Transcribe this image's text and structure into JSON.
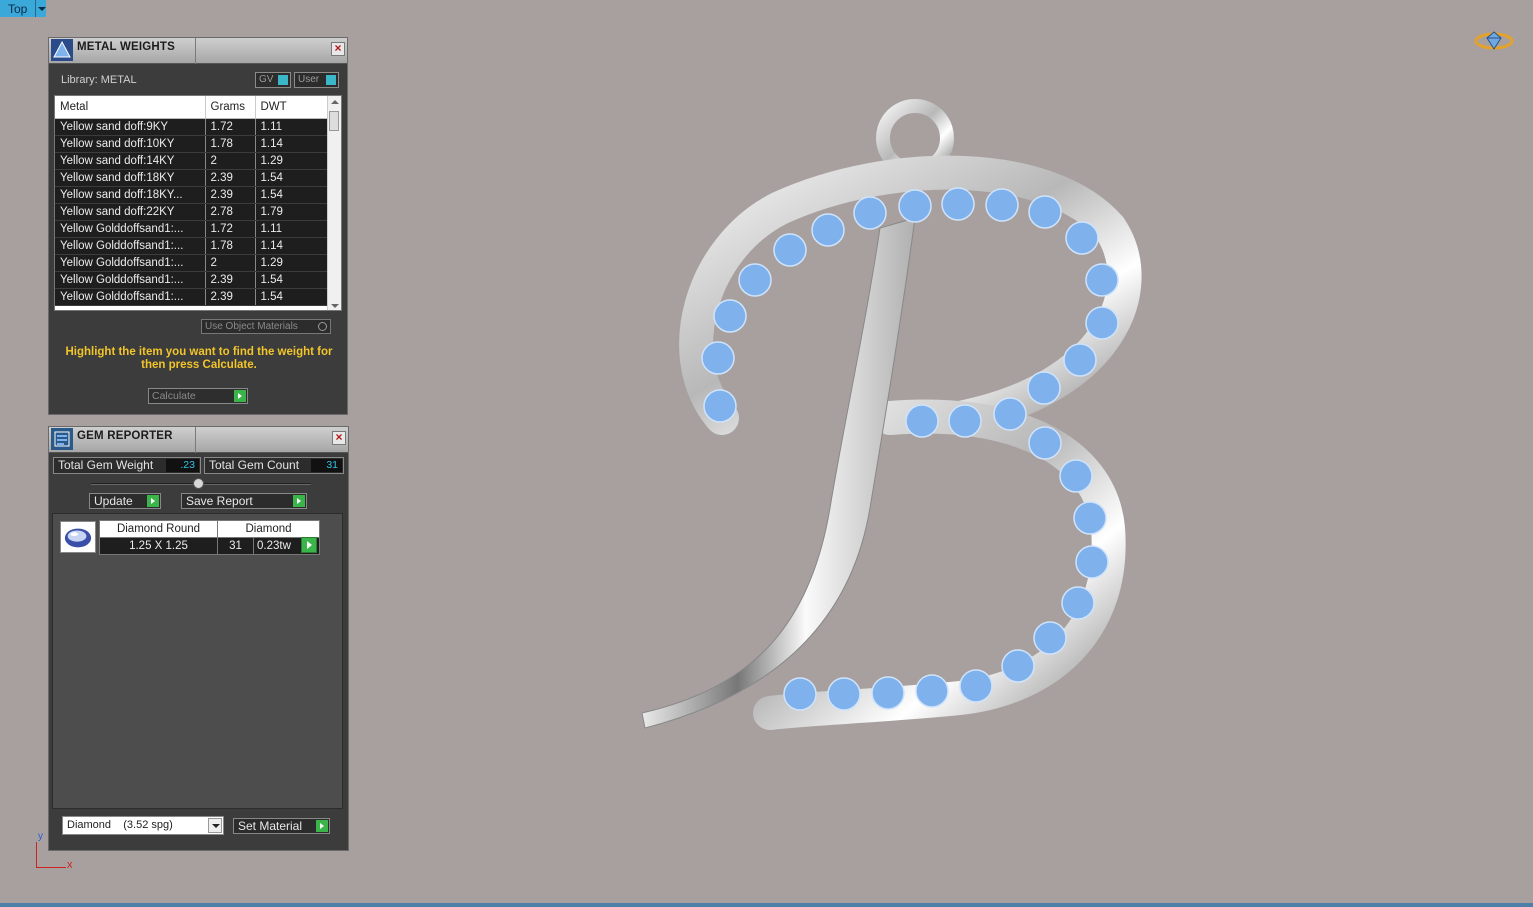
{
  "viewport": {
    "label": "Top",
    "axis_x": "x",
    "axis_y": "y"
  },
  "metal_weights": {
    "title": "METAL WEIGHTS",
    "library": "Library: METAL",
    "gv_label": "GV",
    "user_label": "User",
    "columns": [
      "Metal",
      "Grams",
      "DWT"
    ],
    "rows": [
      [
        "Yellow sand doff:9KY",
        "1.72",
        "1.11"
      ],
      [
        "Yellow sand doff:10KY",
        "1.78",
        "1.14"
      ],
      [
        "Yellow sand doff:14KY",
        "2",
        "1.29"
      ],
      [
        "Yellow sand doff:18KY",
        "2.39",
        "1.54"
      ],
      [
        "Yellow sand doff:18KY...",
        "2.39",
        "1.54"
      ],
      [
        "Yellow sand doff:22KY",
        "2.78",
        "1.79"
      ],
      [
        "Yellow Golddoffsand1:...",
        "1.72",
        "1.11"
      ],
      [
        "Yellow Golddoffsand1:...",
        "1.78",
        "1.14"
      ],
      [
        "Yellow Golddoffsand1:...",
        "2",
        "1.29"
      ],
      [
        "Yellow Golddoffsand1:...",
        "2.39",
        "1.54"
      ],
      [
        "Yellow Golddoffsand1:...",
        "2.39",
        "1.54"
      ]
    ],
    "use_object_materials": "Use Object Materials",
    "hint": "Highlight the item you want to find the weight for then press Calculate.",
    "calculate_label": "Calculate"
  },
  "gem_reporter": {
    "title": "GEM REPORTER",
    "total_weight_label": "Total Gem Weight",
    "total_weight_value": ".23",
    "total_count_label": "Total Gem Count",
    "total_count_value": "31",
    "update_label": "Update",
    "save_report_label": "Save Report",
    "gem": {
      "shape": "Diamond Round",
      "material": "Diamond",
      "size": "1.25 X 1.25",
      "count": "31",
      "weight": "0.23tw"
    },
    "material_select": "Diamond    (3.52 spg)",
    "set_material_label": "Set Material"
  },
  "colors": {
    "viewport_bg": "#a8a09e",
    "accent_yellow": "#f2c52a",
    "value_cyan": "#2ec4e8",
    "go_green": "#39b54a",
    "gem_blue": "#7fb2ec"
  }
}
